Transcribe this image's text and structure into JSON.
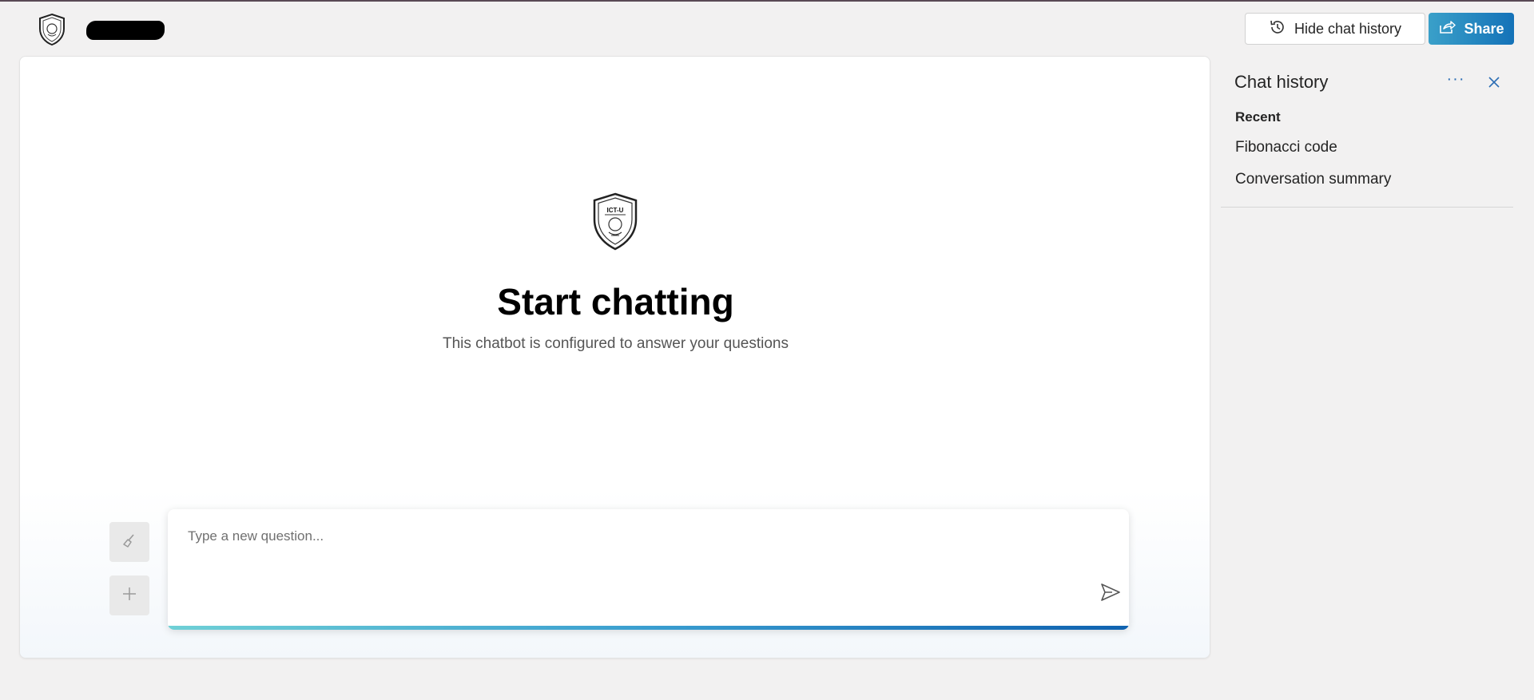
{
  "header": {
    "logo_icon": "shield-crest-logo",
    "hide_history_label": "Hide chat history",
    "share_label": "Share"
  },
  "main": {
    "logo_icon": "ict-u-crest-logo",
    "logo_text": "ICT-U",
    "title": "Start chatting",
    "subtitle": "This chatbot is configured to answer your questions",
    "input_placeholder": "Type a new question..."
  },
  "history": {
    "title": "Chat history",
    "recent_label": "Recent",
    "items": [
      "Fibonacci code",
      "Conversation summary"
    ]
  },
  "colors": {
    "accent": "#1472b8",
    "share_gradient_start": "#3aa0c9",
    "bar_gradient_start": "#6fd0d6",
    "bar_gradient_end": "#0f62b0"
  }
}
